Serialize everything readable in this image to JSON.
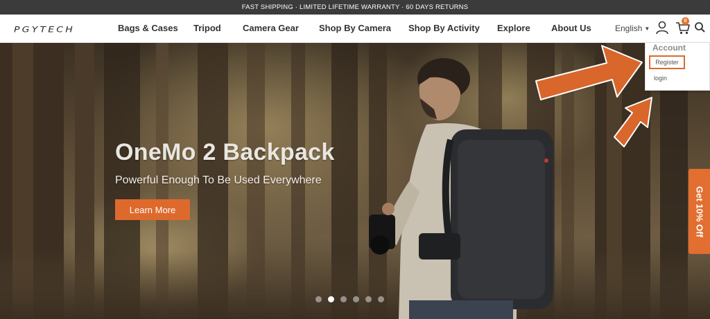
{
  "announcement": "FAST SHIPPING · LIMITED LIFETIME WARRANTY · 60 DAYS RETURNS",
  "brand": {
    "logo_text": "PGYTECH"
  },
  "nav": {
    "items": [
      {
        "label": "Bags & Cases"
      },
      {
        "label": "Tripod"
      },
      {
        "label": "Camera Gear"
      },
      {
        "label": "Shop By Camera"
      },
      {
        "label": "Shop By Activity"
      },
      {
        "label": "Explore"
      },
      {
        "label": "About Us"
      }
    ],
    "language": "English"
  },
  "header_icons": {
    "account": "user-icon",
    "cart": "cart-icon",
    "cart_count": "0",
    "search": "search-icon"
  },
  "account_menu": {
    "title": "Account",
    "register": "Register",
    "login": "login"
  },
  "hero": {
    "title": "OneMo 2 Backpack",
    "subtitle": "Powerful Enough To Be Used Everywhere",
    "cta": "Learn More",
    "slides_total": 6,
    "slide_active": 2
  },
  "discount_tab": "Get 10% Off",
  "colors": {
    "accent": "#dd6a2c",
    "topbar": "#3b3b3b",
    "arrow": "#d9662a"
  }
}
